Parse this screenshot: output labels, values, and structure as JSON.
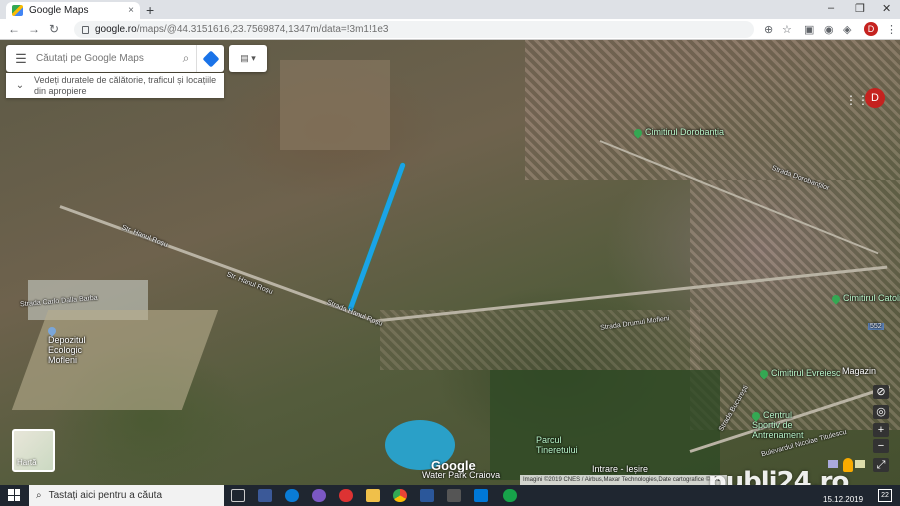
{
  "browser": {
    "tab_title": "Google Maps",
    "tab_close": "×",
    "new_tab": "+",
    "url_host": "google.ro",
    "url_path": "/maps/@44.3151616,23.7569874,1347m/data=!3m1!1e3",
    "profile_initial": "D",
    "window_controls": [
      "–",
      "❐",
      "✕"
    ]
  },
  "search": {
    "placeholder": "Căutați pe Google Maps",
    "hint": "Vedeți duratele de călătorie, traficul și locațiile din apropiere"
  },
  "map": {
    "account_initial": "D",
    "thumbnail_label": "Hartă",
    "google_logo": "Google",
    "attribution": "Imagini ©2019 CNES / Airbus,Maxar Technologies,Date cartografice ©2019",
    "labels": {
      "cimitirul_dorobantia": "Cimitirul Dorobanția",
      "strada_dorobantilor": "Strada Dorobanților",
      "str_hanul_rosu_1": "Str. Hanul Roșu",
      "str_hanul_rosu_2": "Str. Hanul Roșu",
      "strada_hanul_rosu": "Strada Hanul Roșu",
      "strada_carlo_dalla": "Strada Carlo Dalla Barba",
      "depozitul": "Depozitul Ecologic Mofleni",
      "strada_drumul_mofleni": "Strada Drumul Mofleni",
      "cimitirul_catolic": "Cimitirul Catolic",
      "cimitirul_evreiesc": "Cimitirul Evreiesc",
      "magazin": "Magazin",
      "centrul_sportiv": "Centrul Sportiv de Antrenament",
      "parcul": "Parcul Tineretului",
      "intrare": "Intrare - Ieșire",
      "water_park": "Water Park Craiova",
      "strada_bucuresti": "Strada București",
      "bulevardul": "Bulevardul Nicolae Titulescu",
      "shield": "552"
    }
  },
  "watermark": "publi24.ro",
  "taskbar": {
    "search_placeholder": "Tastați aici pentru a căuta",
    "date": "15.12.2019",
    "notification_count": "22"
  },
  "colors": {
    "route": "#1aa3e8",
    "brand_red": "#c5221f",
    "directions_blue": "#1a73e8"
  }
}
